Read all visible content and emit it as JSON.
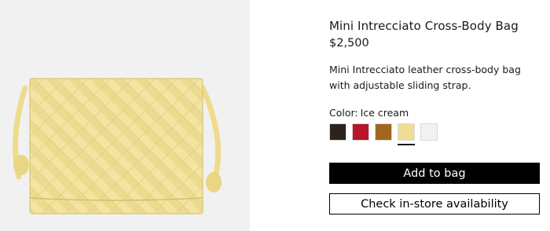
{
  "product": {
    "title": "Mini Intrecciato Cross-Body Bag",
    "price": "$2,500",
    "description": "Mini Intrecciato leather cross-body bag with adjustable sliding strap.",
    "image_icon": "yellow-woven-bag-image"
  },
  "color": {
    "label": "Color:",
    "selected": "Ice cream",
    "swatches": [
      {
        "name": "dark-brown",
        "hex": "#2e221c"
      },
      {
        "name": "red",
        "hex": "#b71728"
      },
      {
        "name": "caramel",
        "hex": "#a3661e"
      },
      {
        "name": "ice-cream",
        "hex": "#f0dd95",
        "selected": true
      },
      {
        "name": "white",
        "hex": "#f2f2f2"
      }
    ]
  },
  "actions": {
    "add_to_bag": "Add to bag",
    "check_store": "Check in-store availability"
  },
  "colors": {
    "primary_button_bg": "#000000",
    "image_bg": "#f1f1f1",
    "bag": "#f1e29c"
  }
}
